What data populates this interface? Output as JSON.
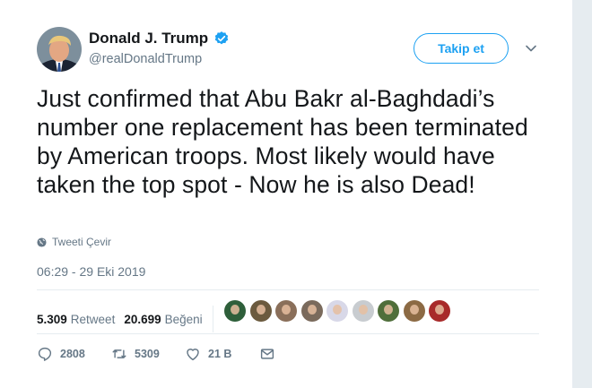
{
  "author": {
    "name": "Donald J. Trump",
    "handle": "@realDonaldTrump",
    "verified": true
  },
  "follow_label": "Takip et",
  "tweet": {
    "text": "Just confirmed that Abu Bakr al-Baghdadi’s number one replacement has been terminated by American troops. Most likely would have taken the top spot - Now he is also Dead!",
    "translate_label": "Tweeti Çevir",
    "timestamp": "06:29 - 29 Eki 2019"
  },
  "stats": {
    "retweets": "5.309",
    "retweets_label": "Retweet",
    "likes": "20.699",
    "likes_label": "Beğeni"
  },
  "likers": [
    {
      "color": "#2e5f3a"
    },
    {
      "color": "#6b5a3e"
    },
    {
      "color": "#8a6f5a"
    },
    {
      "color": "#7a6a5c"
    },
    {
      "color": "#d8d8e8"
    },
    {
      "color": "#c8ccd0"
    },
    {
      "color": "#4f6e3a"
    },
    {
      "color": "#8c6a44"
    },
    {
      "color": "#a82a2a"
    }
  ],
  "actions": {
    "replies": "2808",
    "retweets": "5309",
    "likes": "21 B"
  },
  "colors": {
    "accent": "#1da1f2",
    "muted": "#657786",
    "text": "#14171a"
  }
}
